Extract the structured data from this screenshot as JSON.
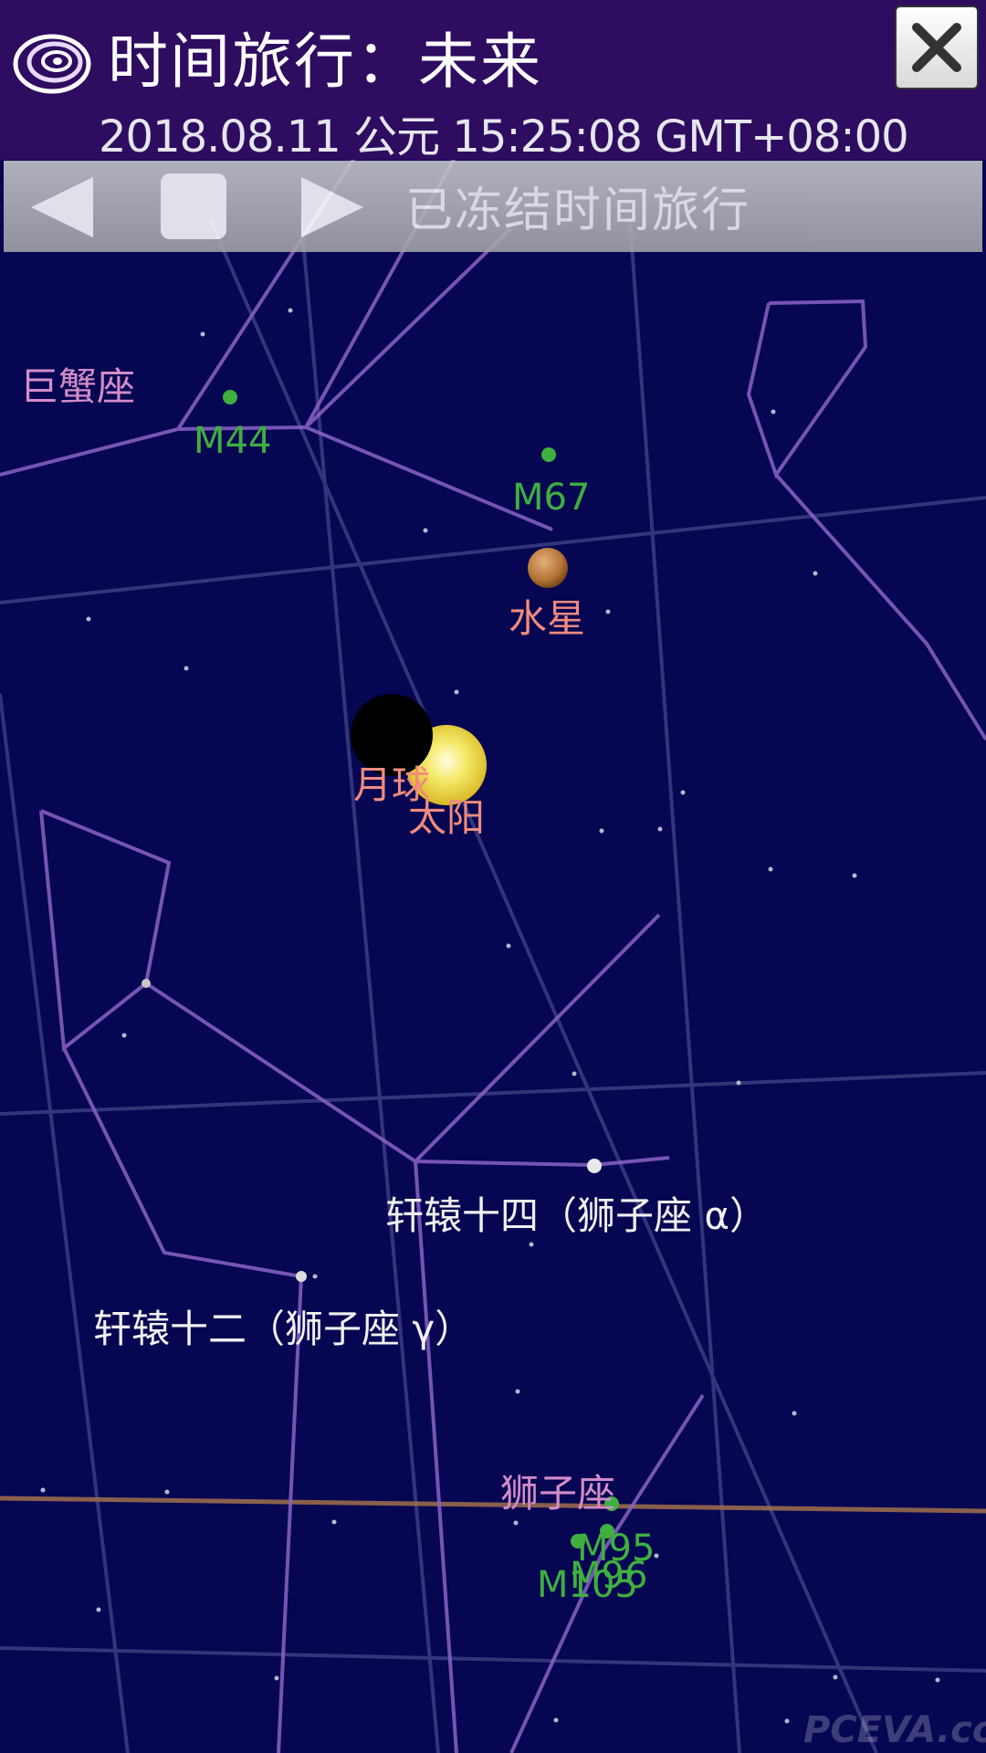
{
  "header": {
    "title": "时间旅行：未来",
    "datetime": "2018.08.11 公元  15:25:08 GMT+08:00"
  },
  "controls": {
    "status": "已冻结时间旅行"
  },
  "sky": {
    "constellations": {
      "cancer": "巨蟹座",
      "leo": "狮子座"
    },
    "messier": {
      "m44": "M44",
      "m67": "M67",
      "m95": "M95",
      "m96": "M96",
      "m105": "M105"
    },
    "bodies": {
      "mercury": "水星",
      "moon": "月球",
      "sun": "太阳"
    },
    "stars": {
      "regulus": "轩辕十四（狮子座 α）",
      "algieba": "轩辕十二（狮子座 γ）"
    }
  },
  "watermark": "PCEVA.com.cn",
  "colors": {
    "sky_background": "#060652",
    "header_background": "#2e0c60",
    "constellation_line": "#8a63c8",
    "constellation_label": "#d48cc8",
    "messier_label": "#3fb03f",
    "planet_label": "#f08b7e",
    "ecliptic": "#a0704a"
  }
}
